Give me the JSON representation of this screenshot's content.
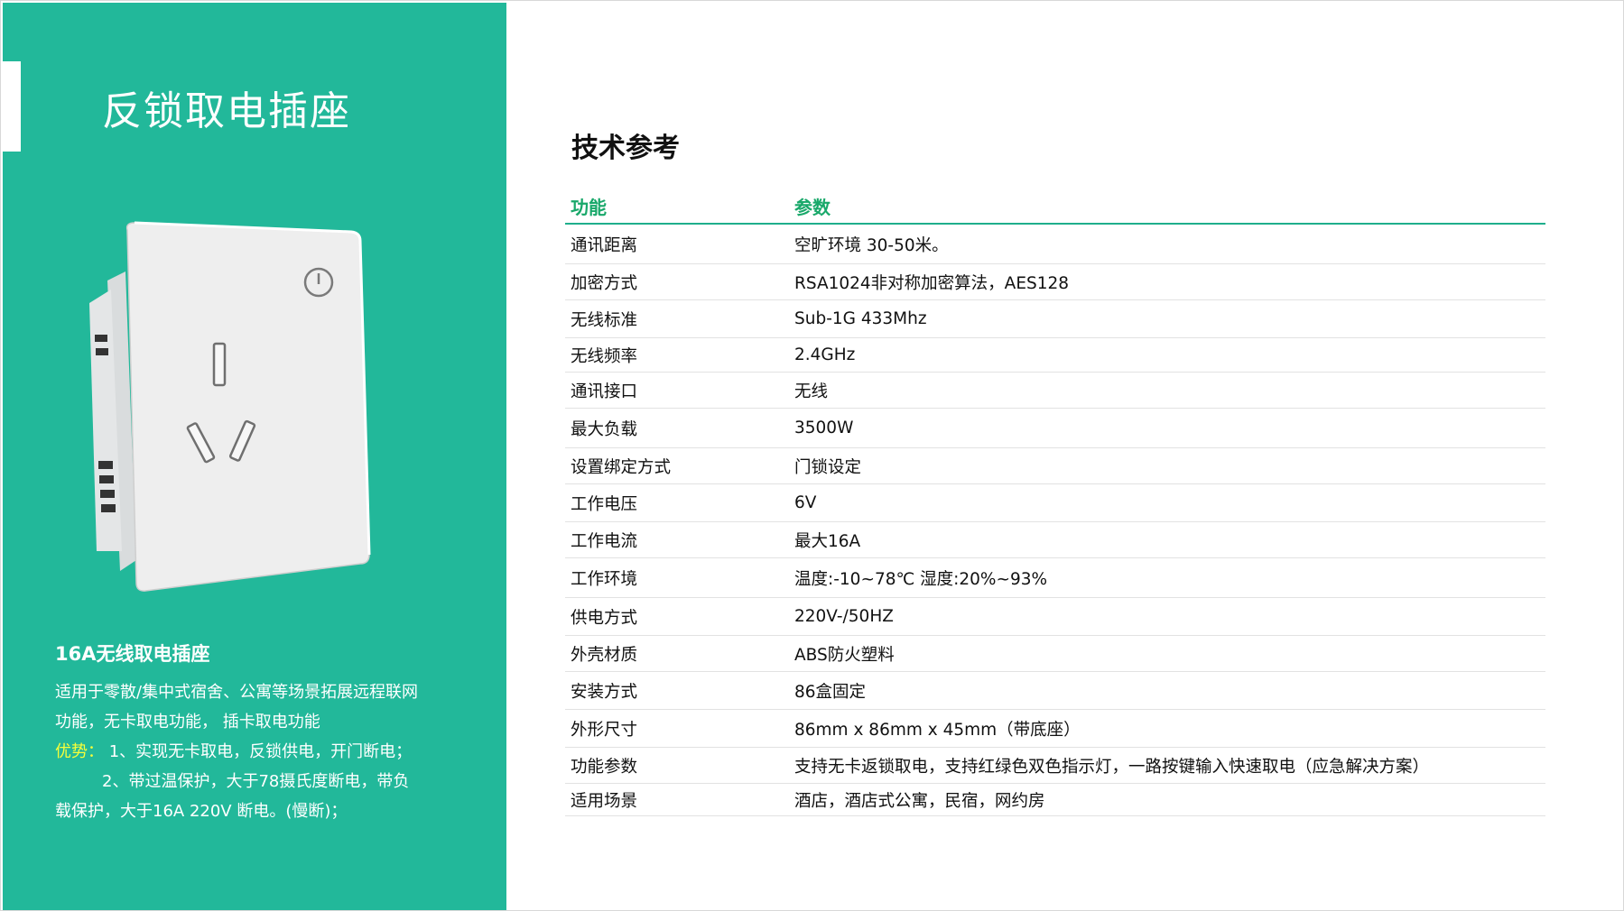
{
  "title": "反锁取电插座",
  "product": {
    "subtitle": "16A无线取电插座",
    "desc_line1": "适用于零散/集中式宿舍、公寓等场景拓展远程联网",
    "desc_line2": "功能，无卡取电功能， 插卡取电功能",
    "adv_label": "优势：",
    "adv_line1": " 1、实现无卡取电，反锁供电，开门断电；",
    "adv_line2": "2、带过温保护，大于78摄氏度断电，带负",
    "adv_line3": "载保护，大于16A 220V 断电。(慢断)；"
  },
  "tech": {
    "title": "技术参考",
    "headers": [
      "功能",
      "参数"
    ],
    "rows": [
      [
        "通讯距离",
        "空旷环境 30-50米。"
      ],
      [
        "加密方式",
        "RSA1024非对称加密算法，AES128"
      ],
      [
        "无线标准",
        "Sub-1G 433Mhz"
      ],
      [
        "无线频率",
        "2.4GHz"
      ],
      [
        "通讯接口",
        "无线"
      ],
      [
        "最大负载",
        "3500W"
      ],
      [
        "设置绑定方式",
        "门锁设定"
      ],
      [
        "工作电压",
        "6V"
      ],
      [
        "工作电流",
        "最大16A"
      ],
      [
        "工作环境",
        "温度:-10~78℃ 湿度:20%~93%"
      ],
      [
        "供电方式",
        "220V-/50HZ"
      ],
      [
        "外壳材质",
        "ABS防火塑料"
      ],
      [
        "安装方式",
        "86盒固定"
      ],
      [
        "外形尺寸",
        "86mm x 86mm x 45mm（带底座）"
      ],
      [
        " 功能参数",
        "支持无卡返锁取电，支持红绿色双色指示灯，一路按键输入快速取电（应急解决方案）"
      ],
      [
        "适用场景",
        "酒店，酒店式公寓，民宿，网约房"
      ]
    ]
  },
  "colors": {
    "panel_green": "#22b89a",
    "header_green": "#19a86a",
    "advantage_yellow": "#f6ff3a"
  }
}
